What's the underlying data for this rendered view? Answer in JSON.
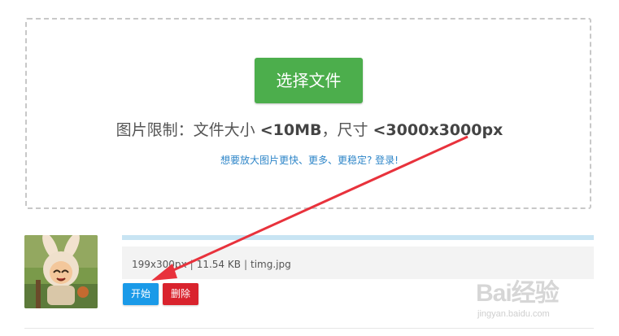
{
  "upload": {
    "select_button": "选择文件",
    "limit_prefix": "图片限制：文件大小 ",
    "limit_size": "<10MB",
    "limit_middle": "，尺寸 ",
    "limit_dimensions": "<3000x3000px",
    "login_prompt": "想要放大图片更快、更多、更稳定? 登录!"
  },
  "file": {
    "dimensions": "199x300px",
    "size": "11.54 KB",
    "name": "timg.jpg",
    "progress": 0,
    "separator": "|"
  },
  "actions": {
    "start_label": "开始",
    "delete_label": "删除"
  },
  "watermark": {
    "logo": "Bai经验",
    "url": "jingyan.baidu.com"
  },
  "colors": {
    "select_button": "#4cae4c",
    "start_button": "#1a9ae8",
    "delete_button": "#d9232d",
    "link": "#2d85c8",
    "arrow": "#e8323c"
  }
}
